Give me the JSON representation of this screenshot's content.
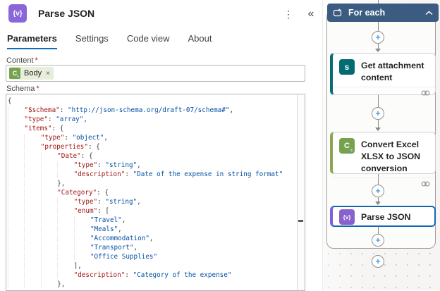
{
  "panel": {
    "title": "Parse JSON",
    "title_icon_glyph": "{v}",
    "more_icon": "⋮",
    "collapse_icon": "«",
    "tabs": [
      {
        "label": "Parameters",
        "active": true
      },
      {
        "label": "Settings",
        "active": false
      },
      {
        "label": "Code view",
        "active": false
      },
      {
        "label": "About",
        "active": false
      }
    ],
    "content_field": {
      "label": "Content",
      "required_mark": "*",
      "token": {
        "icon_letter": "C",
        "text": "Body",
        "remove_glyph": "×"
      }
    },
    "schema_field": {
      "label": "Schema",
      "required_mark": "*",
      "lines": [
        "{",
        "    \"$schema\": \"http://json-schema.org/draft-07/schema#\",",
        "    \"type\": \"array\",",
        "    \"items\": {",
        "        \"type\": \"object\",",
        "        \"properties\": {",
        "            \"Date\": {",
        "                \"type\": \"string\",",
        "                \"description\": \"Date of the expense in string format\"",
        "            },",
        "            \"Category\": {",
        "                \"type\": \"string\",",
        "                \"enum\": [",
        "                    \"Travel\",",
        "                    \"Meals\",",
        "                    \"Accommodation\",",
        "                    \"Transport\",",
        "                    \"Office Supplies\"",
        "                ],",
        "                \"description\": \"Category of the expense\"",
        "            },"
      ]
    }
  },
  "flow": {
    "for_each": {
      "label": "For each"
    },
    "nodes": [
      {
        "label": "Get attachment content",
        "icon_text": "s",
        "icon_color": "#036c70",
        "accent_color": "#066e72",
        "selected": false,
        "has_connection_icon": true
      },
      {
        "label": "Convert Excel XLSX to JSON conversion",
        "icon_text": "C",
        "icon_color": "#76a24e",
        "accent_color": "#8ca552",
        "selected": false,
        "has_connection_icon": true
      },
      {
        "label": "Parse JSON",
        "icon_text": "{v}",
        "icon_color": "#8961cc",
        "accent_color": "#7c5fdc",
        "selected": true,
        "has_connection_icon": false
      }
    ]
  },
  "icons": {
    "plus": "+"
  },
  "colors": {
    "tab_active_underline": "#0f6cbd",
    "scope_header": "#3b5c80",
    "plus_accent": "#0078d4",
    "selected_border": "#1267b4",
    "json_key": "#a31515",
    "json_value": "#0451a5"
  }
}
